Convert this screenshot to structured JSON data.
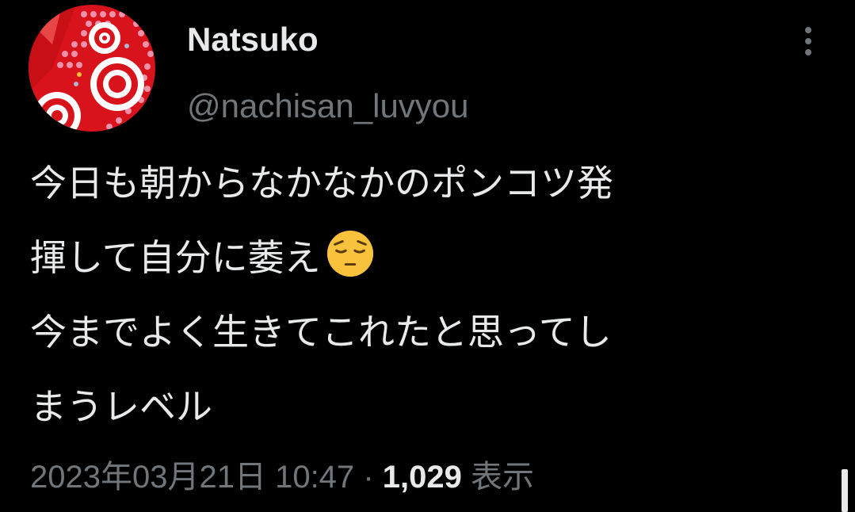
{
  "tweet": {
    "display_name": "Natsuko",
    "handle": "@nachisan_luvyou",
    "more_icon": "more-vertical-icon",
    "avatar_icon": "avatar-image",
    "text_lines": [
      "今日も朝からなかなかのポンコツ発",
      "揮して自分に萎え",
      "今までよく生きてこれたと思ってし",
      "まうレベル"
    ],
    "emoji": "pensive-face-emoji",
    "timestamp": "2023年03月21日 10:47",
    "separator": "·",
    "views_count": "1,029",
    "views_label": "表示"
  },
  "colors": {
    "background": "#000000",
    "primary_text": "#e7e9ea",
    "secondary_text": "#71767b",
    "avatar_red": "#d8131b",
    "emoji_yellow": "#f9c23c"
  }
}
